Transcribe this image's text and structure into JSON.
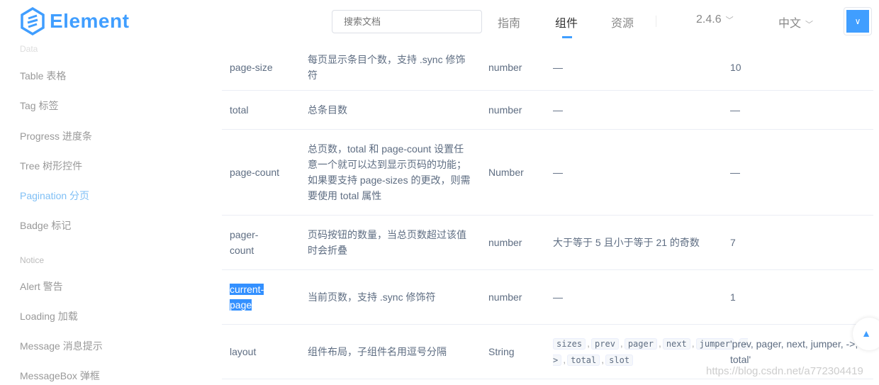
{
  "header": {
    "logo": "Element",
    "search_placeholder": "搜索文档",
    "nav": [
      "指南",
      "组件",
      "资源"
    ],
    "active_nav": "组件",
    "version": "2.4.6",
    "language": "中文"
  },
  "sidebar": {
    "partial_group": "Data",
    "items": [
      "Table 表格",
      "Tag 标签",
      "Progress 进度条",
      "Tree 树形控件",
      "Pagination 分页",
      "Badge 标记"
    ],
    "active": "Pagination 分页",
    "group": "Notice",
    "items2": [
      "Alert 警告",
      "Loading 加载",
      "Message 消息提示",
      "MessageBox 弹框"
    ]
  },
  "table": {
    "rows": [
      {
        "param": "page-size",
        "desc": "每页显示条目个数，支持 .sync 修饰符",
        "type": "number",
        "options": "—",
        "default": "10"
      },
      {
        "param": "total",
        "desc": "总条目数",
        "type": "number",
        "options": "—",
        "default": "—"
      },
      {
        "param": "page-count",
        "desc": "总页数，total 和 page-count 设置任意一个就可以达到显示页码的功能；如果要支持 page-sizes 的更改，则需要使用 total 属性",
        "type": "Number",
        "options": "—",
        "default": "—"
      },
      {
        "param": "pager-count",
        "desc": "页码按钮的数量，当总页数超过该值时会折叠",
        "type": "number",
        "options": "大于等于 5 且小于等于 21 的奇数",
        "default": "7"
      },
      {
        "param": "current-page",
        "desc": "当前页数，支持 .sync 修饰符",
        "type": "number",
        "options": "—",
        "default": "1"
      },
      {
        "param": "layout",
        "desc": "组件布局，子组件名用逗号分隔",
        "type": "String",
        "options_codes": [
          "sizes",
          "prev",
          "pager",
          "next",
          "jumper",
          "->",
          "total",
          "slot"
        ],
        "default": "'prev, pager, next, jumper, ->, total'"
      }
    ]
  },
  "watermark": "https://blog.csdn.net/a772304419",
  "colors": {
    "accent": "#409eff",
    "selection": "#3390ff"
  }
}
